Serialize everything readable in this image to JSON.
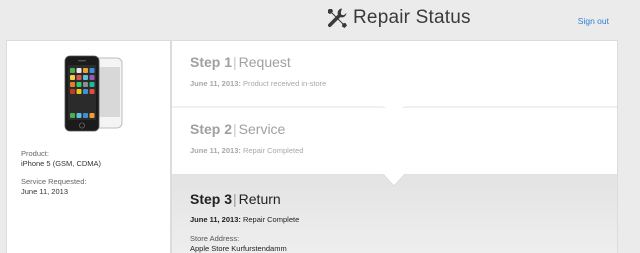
{
  "header": {
    "title": "Repair Status",
    "title_icon": "tools-icon",
    "sign_out": "Sign out",
    "link_color": "#2f82d6"
  },
  "device": {
    "product_label": "Product:",
    "product_value": "iPhone 5 (GSM, CDMA)",
    "service_label": "Service Requested:",
    "service_value": "June 11, 2013"
  },
  "steps": [
    {
      "step": "Step 1",
      "name": "Request",
      "date": "June 11, 2013:",
      "status": "Product received in-store"
    },
    {
      "step": "Step 2",
      "name": "Service",
      "date": "June 11, 2013:",
      "status": "Repair Completed"
    },
    {
      "step": "Step 3",
      "name": "Return",
      "date": "June 11, 2013:",
      "status": "Repair Complete",
      "store_label": "Store Address:",
      "store_value": "Apple Store Kurfurstendamm"
    }
  ]
}
